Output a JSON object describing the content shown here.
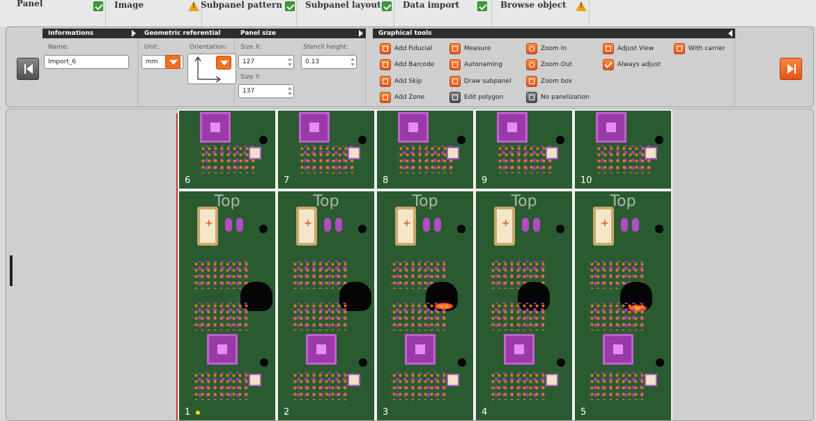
{
  "tabs": [
    {
      "label": "Panel",
      "status": "ok"
    },
    {
      "label": "Image",
      "status": "warning"
    },
    {
      "label": "Subpanel pattern",
      "status": "ok"
    },
    {
      "label": "Subpanel layout",
      "status": "ok"
    },
    {
      "label": "Data import",
      "status": "ok"
    },
    {
      "label": "Browse object",
      "status": "warning"
    }
  ],
  "sections": {
    "informations": {
      "title": "Informations",
      "name_label": "Name:",
      "name_value": "Import_6"
    },
    "geometric": {
      "title": "Geometric referential",
      "unit_label": "Unit:",
      "unit_value": "mm",
      "orientation_label": "Orientation:"
    },
    "panel_size": {
      "title": "Panel size",
      "size_x_label": "Size X:",
      "size_x_value": "127",
      "size_y_label": "Size Y:",
      "size_y_value": "137",
      "stencil_label": "Stencil height:",
      "stencil_value": "0.13"
    },
    "graphical_tools": {
      "title": "Graphical tools",
      "tools": [
        {
          "label": "Add Fiducial",
          "icon": "fiducial-icon"
        },
        {
          "label": "Add Barcode",
          "icon": "barcode-icon"
        },
        {
          "label": "Add Skip",
          "icon": "skip-icon"
        },
        {
          "label": "Add Zone",
          "icon": "zone-icon"
        },
        {
          "label": "Measure",
          "icon": "measure-icon"
        },
        {
          "label": "Autonaming",
          "icon": "autonaming-icon"
        },
        {
          "label": "Draw subpanel",
          "icon": "draw-subpanel-icon"
        },
        {
          "label": "Edit polygon",
          "icon": "edit-polygon-icon"
        },
        {
          "label": "Zoom In",
          "icon": "zoom-in-icon"
        },
        {
          "label": "Zoom Out",
          "icon": "zoom-out-icon"
        },
        {
          "label": "Zoom box",
          "icon": "zoom-box-icon"
        },
        {
          "label": "No panelization",
          "icon": "no-panelization-icon"
        },
        {
          "label": "Adjust View",
          "icon": "adjust-view-icon"
        },
        {
          "label": "Always adjust",
          "icon": "checkbox-checked-icon"
        },
        {
          "label": "With carrier",
          "icon": "carrier-icon"
        }
      ]
    }
  },
  "board": {
    "top_row_numbers": [
      "6",
      "7",
      "8",
      "9",
      "10"
    ],
    "bottom_row_numbers": [
      "1",
      "2",
      "3",
      "4",
      "5"
    ],
    "side_label": "Top"
  },
  "colors": {
    "accent": "#f07020",
    "ok": "#3a9d3a",
    "warning": "#f0a010",
    "pcb": "#2a5a30"
  }
}
